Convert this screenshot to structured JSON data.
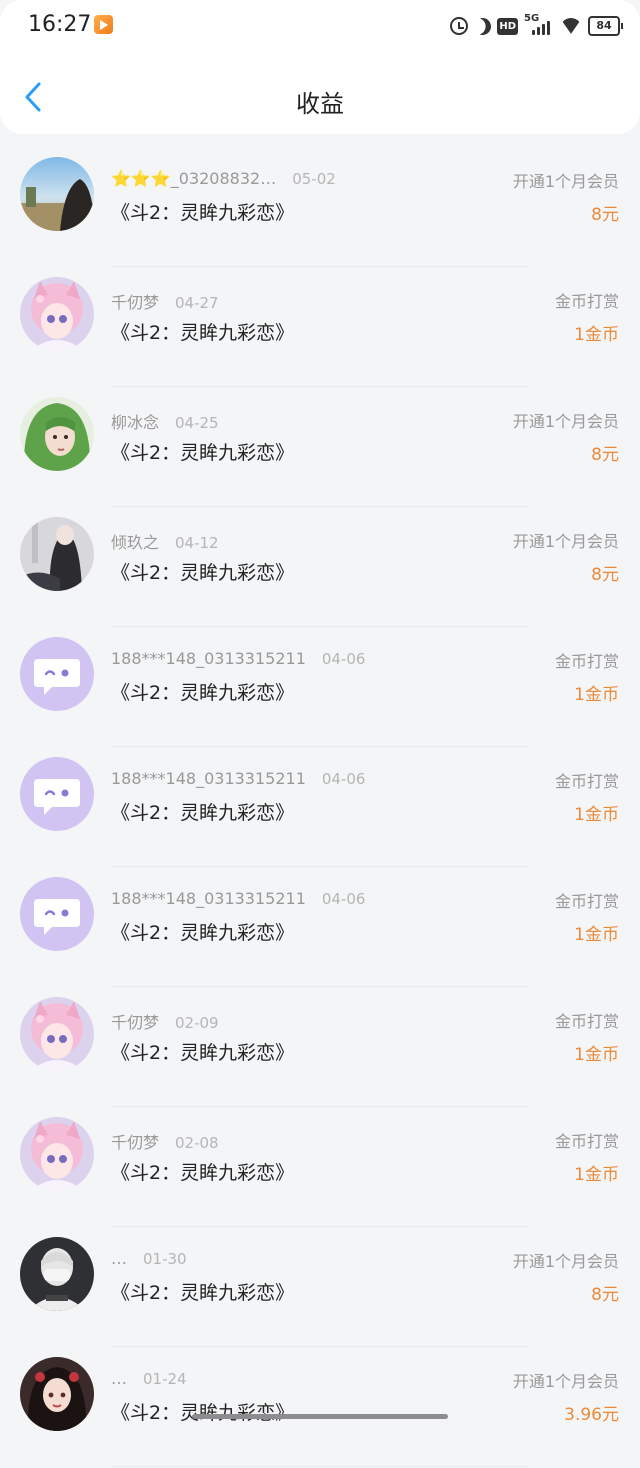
{
  "status_bar": {
    "time": "16:27",
    "network": "5G",
    "hd": "HD",
    "battery": "84"
  },
  "nav": {
    "title": "收益",
    "accent_color": "#2a9cf5"
  },
  "colors": {
    "amount": "#ed8a3a",
    "meta": "#999999",
    "divider": "#e7e8ea"
  },
  "records": [
    {
      "user": "⭐⭐⭐_03208832…",
      "date": "05-02",
      "book": "《斗2：灵眸九彩恋》",
      "type": "开通1个月会员",
      "amount": "8元",
      "avatar": "landscape"
    },
    {
      "user": "千仞梦",
      "date": "04-27",
      "book": "《斗2：灵眸九彩恋》",
      "type": "金币打赏",
      "amount": "1金币",
      "avatar": "pink-anime-girl"
    },
    {
      "user": "柳冰念",
      "date": "04-25",
      "book": "《斗2：灵眸九彩恋》",
      "type": "开通1个月会员",
      "amount": "8元",
      "avatar": "green-hair-girl"
    },
    {
      "user": "倾玖之",
      "date": "04-12",
      "book": "《斗2：灵眸九彩恋》",
      "type": "开通1个月会员",
      "amount": "8元",
      "avatar": "dark-figure"
    },
    {
      "user": "188***148_0313315211",
      "date": "04-06",
      "book": "《斗2：灵眸九彩恋》",
      "type": "金币打赏",
      "amount": "1金币",
      "avatar": "default-chat-bubble"
    },
    {
      "user": "188***148_0313315211",
      "date": "04-06",
      "book": "《斗2：灵眸九彩恋》",
      "type": "金币打赏",
      "amount": "1金币",
      "avatar": "default-chat-bubble"
    },
    {
      "user": "188***148_0313315211",
      "date": "04-06",
      "book": "《斗2：灵眸九彩恋》",
      "type": "金币打赏",
      "amount": "1金币",
      "avatar": "default-chat-bubble"
    },
    {
      "user": "千仞梦",
      "date": "02-09",
      "book": "《斗2：灵眸九彩恋》",
      "type": "金币打赏",
      "amount": "1金币",
      "avatar": "pink-anime-girl"
    },
    {
      "user": "千仞梦",
      "date": "02-08",
      "book": "《斗2：灵眸九彩恋》",
      "type": "金币打赏",
      "amount": "1金币",
      "avatar": "pink-anime-girl"
    },
    {
      "user": "…",
      "date": "01-30",
      "book": "《斗2：灵眸九彩恋》",
      "type": "开通1个月会员",
      "amount": "8元",
      "avatar": "masked-boy"
    },
    {
      "user": "…",
      "date": "01-24",
      "book": "《斗2：灵眸九彩恋》",
      "type": "开通1个月会员",
      "amount": "3.96元",
      "avatar": "dark-hair-girl"
    }
  ]
}
